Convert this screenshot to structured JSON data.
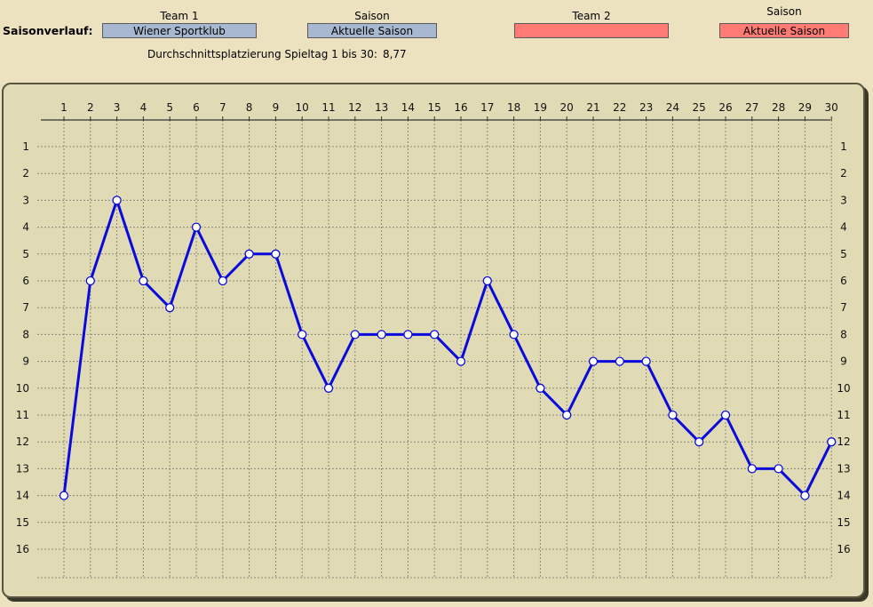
{
  "header": {
    "title_label": "Saisonverlauf:",
    "team1_label": "Team 1",
    "team1_value": "Wiener Sportklub",
    "season1_label": "Saison",
    "season1_value": "Aktuelle Saison",
    "team2_label": "Team 2",
    "team2_value": "",
    "season2_label": "Saison",
    "season2_value": "Aktuelle Saison",
    "avg_label": "Durchschnittsplatzierung Spieltag 1 bis 30:",
    "avg_value": "8,77"
  },
  "colors": {
    "background": "#ECE2C0",
    "plot_background": "#E0DBB4",
    "team1_field": "#A8B8D0",
    "team2_field": "#FF7B73",
    "series_line": "#0A0ADC",
    "marker_fill": "#FFFFFF",
    "grid": "#8a8a7a"
  },
  "chart_data": {
    "type": "line",
    "title": "",
    "xlabel": "",
    "ylabel": "",
    "x": [
      1,
      2,
      3,
      4,
      5,
      6,
      7,
      8,
      9,
      10,
      11,
      12,
      13,
      14,
      15,
      16,
      17,
      18,
      19,
      20,
      21,
      22,
      23,
      24,
      25,
      26,
      27,
      28,
      29,
      30
    ],
    "y_ticks": [
      1,
      2,
      3,
      4,
      5,
      6,
      7,
      8,
      9,
      10,
      11,
      12,
      13,
      14,
      15,
      16
    ],
    "ylim": [
      17,
      0
    ],
    "y_inverted": true,
    "grid": true,
    "x_axis_position": "top",
    "y_axis_labels": "both sides",
    "series": [
      {
        "values": [
          14,
          6,
          3,
          6,
          7,
          4,
          6,
          5,
          5,
          8,
          10,
          8,
          8,
          8,
          8,
          9,
          6,
          8,
          10,
          11,
          9,
          9,
          9,
          11,
          12,
          11,
          13,
          13,
          14,
          12
        ]
      }
    ]
  }
}
